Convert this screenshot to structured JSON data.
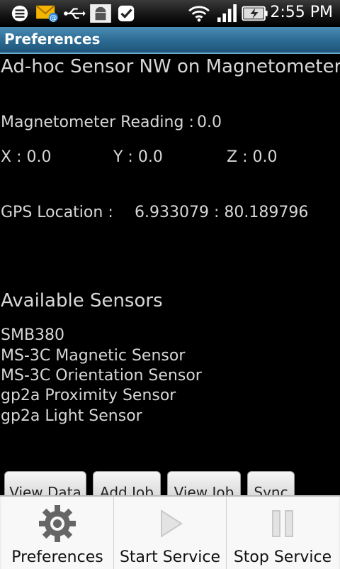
{
  "status_bar": {
    "time": "2:55 PM",
    "icons": [
      "menu-icon",
      "gmail-notification-icon",
      "usb-icon",
      "android-debug-icon",
      "task-check-icon",
      "wifi-icon",
      "signal-icon",
      "battery-charging-icon"
    ]
  },
  "title_bar": {
    "title": "Preferences"
  },
  "content": {
    "header": "Ad-hoc Sensor NW on Magnetometer",
    "magnetometer_label": "Magnetometer Reading :",
    "magnetometer_value": "0.0",
    "x_label": "X : 0.0",
    "y_label": "Y : 0.0",
    "z_label": "Z : 0.0",
    "gps_label": "GPS Location :",
    "gps_value": "6.933079 : 80.189796",
    "sensors_header": "Available Sensors",
    "sensors": [
      "SMB380",
      "MS-3C Magnetic Sensor",
      "MS-3C Orientation Sensor",
      "gp2a Proximity Sensor",
      "gp2a Light Sensor"
    ]
  },
  "buttons": {
    "view_data": "View Data",
    "add_job": "Add Job",
    "view_job": "View Job",
    "sync": "Sync"
  },
  "menu": {
    "preferences": "Preferences",
    "start_service": "Start Service",
    "stop_service": "Stop Service"
  }
}
